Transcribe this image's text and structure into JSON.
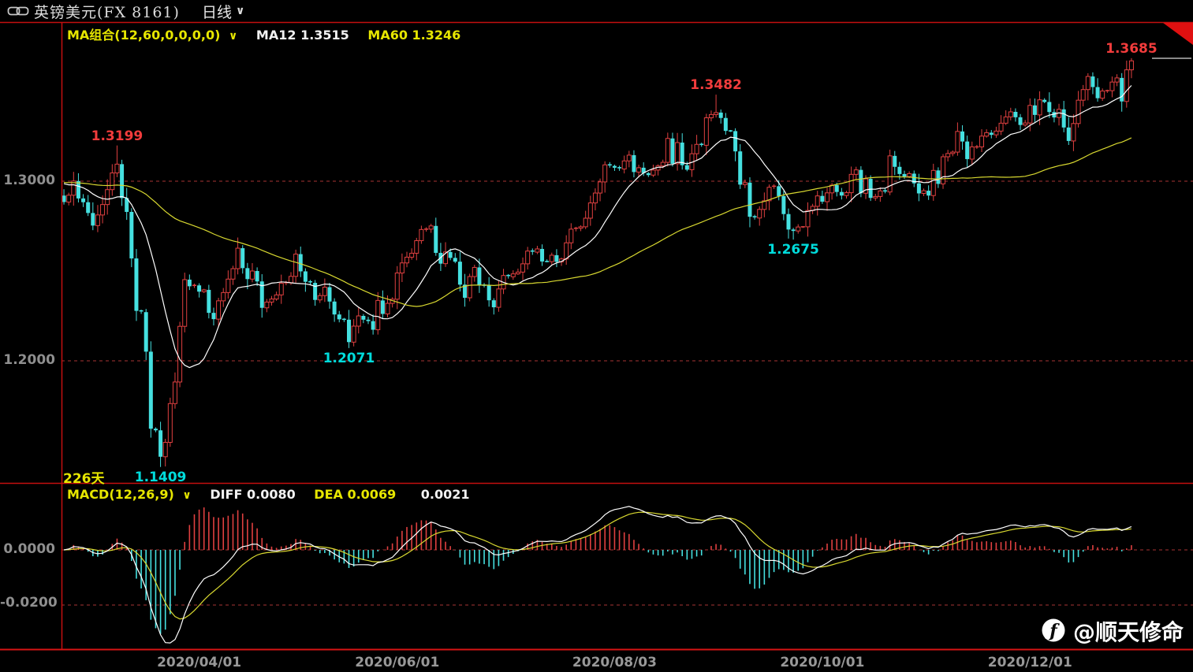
{
  "title_bar": {
    "instrument": "英镑美元(FX 8161)",
    "period": "日线"
  },
  "icons": {
    "caret_glyph": "∨",
    "link_icon": "chain-link",
    "watermark_logo": "toutiao-f-logo"
  },
  "main_indicator": {
    "label": "MA组合(12,60,0,0,0,0)",
    "ma12": "MA12 1.3515",
    "ma60": "MA60 1.3246"
  },
  "sub_indicator": {
    "label": "MACD(12,26,9)",
    "diff": "DIFF 0.0080",
    "dea": "DEA 0.0069",
    "macd": "0.0021"
  },
  "footer": {
    "bar_count": "226天"
  },
  "watermark": {
    "handle": "@顺天修命"
  },
  "chart_data": {
    "type": "candlestick",
    "title": "英镑美元(FX 8161) 日线",
    "bars": 222,
    "ylim_main": [
      1.14,
      1.385
    ],
    "ylim_sub": [
      -0.036,
      0.022
    ],
    "grid": "dashed-red",
    "closes": [
      1.2884,
      1.2922,
      1.3001,
      1.2904,
      1.2883,
      1.2823,
      1.2753,
      1.2812,
      1.287,
      1.2953,
      1.3046,
      1.3095,
      1.2906,
      1.2829,
      1.257,
      1.2278,
      1.2271,
      1.2051,
      1.1622,
      1.1613,
      1.1466,
      1.1546,
      1.1762,
      1.1882,
      1.2192,
      1.2452,
      1.2415,
      1.242,
      1.2385,
      1.2395,
      1.2267,
      1.2232,
      1.2334,
      1.238,
      1.2455,
      1.2513,
      1.2627,
      1.2516,
      1.2455,
      1.25,
      1.2442,
      1.2295,
      1.2327,
      1.2344,
      1.2367,
      1.2432,
      1.2435,
      1.247,
      1.2594,
      1.2498,
      1.244,
      1.2434,
      1.2339,
      1.2363,
      1.241,
      1.233,
      1.2258,
      1.2231,
      1.2229,
      1.2104,
      1.2193,
      1.225,
      1.2229,
      1.2221,
      1.2173,
      1.2336,
      1.2261,
      1.232,
      1.2343,
      1.2489,
      1.2545,
      1.2577,
      1.2599,
      1.2669,
      1.2731,
      1.2733,
      1.2751,
      1.2601,
      1.2541,
      1.2606,
      1.2573,
      1.2552,
      1.2424,
      1.2351,
      1.2469,
      1.252,
      1.2421,
      1.242,
      1.2337,
      1.2298,
      1.24,
      1.2475,
      1.2468,
      1.2484,
      1.2494,
      1.254,
      1.2611,
      1.2605,
      1.2623,
      1.2553,
      1.2552,
      1.2588,
      1.2551,
      1.2567,
      1.2657,
      1.2733,
      1.2738,
      1.2746,
      1.2794,
      1.2879,
      1.2934,
      1.2996,
      1.3091,
      1.3085,
      1.3075,
      1.3068,
      1.3113,
      1.3145,
      1.3051,
      1.3075,
      1.3045,
      1.3034,
      1.3062,
      1.3085,
      1.3105,
      1.3238,
      1.3097,
      1.3215,
      1.3089,
      1.3064,
      1.3153,
      1.3205,
      1.32,
      1.3353,
      1.3371,
      1.3382,
      1.3352,
      1.328,
      1.3279,
      1.3166,
      1.2981,
      1.2992,
      1.2802,
      1.2795,
      1.2843,
      1.2891,
      1.2966,
      1.2972,
      1.2917,
      1.2817,
      1.2731,
      1.2723,
      1.2745,
      1.2746,
      1.2837,
      1.286,
      1.2918,
      1.2886,
      1.2935,
      1.2978,
      1.294,
      1.292,
      1.2936,
      1.3038,
      1.3063,
      1.2933,
      1.3013,
      1.2907,
      1.2915,
      1.2946,
      1.294,
      1.3141,
      1.308,
      1.304,
      1.3026,
      1.3042,
      1.2988,
      1.2932,
      1.2947,
      1.292,
      1.306,
      1.2985,
      1.3136,
      1.3154,
      1.3162,
      1.3277,
      1.3221,
      1.3123,
      1.3191,
      1.3191,
      1.3251,
      1.327,
      1.3258,
      1.3279,
      1.3323,
      1.3358,
      1.3386,
      1.3356,
      1.3313,
      1.3324,
      1.3422,
      1.3369,
      1.3453,
      1.3441,
      1.3385,
      1.3355,
      1.34,
      1.3299,
      1.3224,
      1.3321,
      1.3451,
      1.351,
      1.3583,
      1.3524,
      1.3462,
      1.3502,
      1.3504,
      1.3552,
      1.3575,
      1.3444,
      1.362,
      1.367
    ],
    "wick_overrides": [
      {
        "index": 11,
        "high": 1.3199
      },
      {
        "index": 20,
        "low": 1.1409
      },
      {
        "index": 59,
        "low": 1.2071
      },
      {
        "index": 135,
        "high": 1.3482
      },
      {
        "index": 151,
        "low": 1.2675
      },
      {
        "index": 221,
        "high": 1.3685
      }
    ],
    "annotations": [
      {
        "index": 11,
        "text": "1.3199",
        "color": "red",
        "side": "above",
        "price": 1.3199
      },
      {
        "index": 135,
        "text": "1.3482",
        "color": "red",
        "side": "above",
        "price": 1.3482
      },
      {
        "index": 221,
        "text": "1.3685",
        "color": "red",
        "side": "above",
        "price": 1.3685
      },
      {
        "index": 20,
        "text": "1.1409",
        "color": "cyan",
        "side": "below",
        "price": 1.1409
      },
      {
        "index": 59,
        "text": "1.2071",
        "color": "cyan",
        "side": "below",
        "price": 1.2071
      },
      {
        "index": 151,
        "text": "1.2675",
        "color": "cyan",
        "side": "below",
        "price": 1.2675
      }
    ],
    "last_price": 1.3685,
    "main_axis": {
      "gridlines": [
        {
          "text": "1.3000",
          "value": 1.3
        },
        {
          "text": "1.2000",
          "value": 1.2
        }
      ]
    },
    "sub_axis": {
      "gridlines": [
        {
          "text": "0.0000",
          "value": 0
        },
        {
          "text": "-0.0200",
          "value": -0.02
        }
      ]
    },
    "x_axis_labels": [
      {
        "text": "2020/04/01",
        "index": 28
      },
      {
        "text": "2020/06/01",
        "index": 69
      },
      {
        "text": "2020/08/03",
        "index": 114
      },
      {
        "text": "2020/10/01",
        "index": 157
      },
      {
        "text": "2020/12/01",
        "index": 200
      }
    ],
    "indicators": {
      "ma": [
        {
          "name": "MA12",
          "period": 12,
          "color": "#ffffff"
        },
        {
          "name": "MA60",
          "period": 60,
          "color": "#d8d830"
        }
      ],
      "macd": {
        "fast": 12,
        "slow": 26,
        "signal": 9,
        "diff_value": 0.008,
        "dea_value": 0.0069,
        "hist_value": 0.0021
      }
    },
    "colors": {
      "up": "#e04040",
      "down": "#45e0e0",
      "diff_line": "#ffffff",
      "dea_line": "#d8d830",
      "frame": "#c40f0f",
      "grid": "#a83434",
      "axis_text": "#8f8f8f",
      "ann_red": "#f23c3c",
      "ann_cyan": "#00dcdc",
      "ref_dash": "#b5b5b5",
      "fold": "#e01010"
    }
  }
}
